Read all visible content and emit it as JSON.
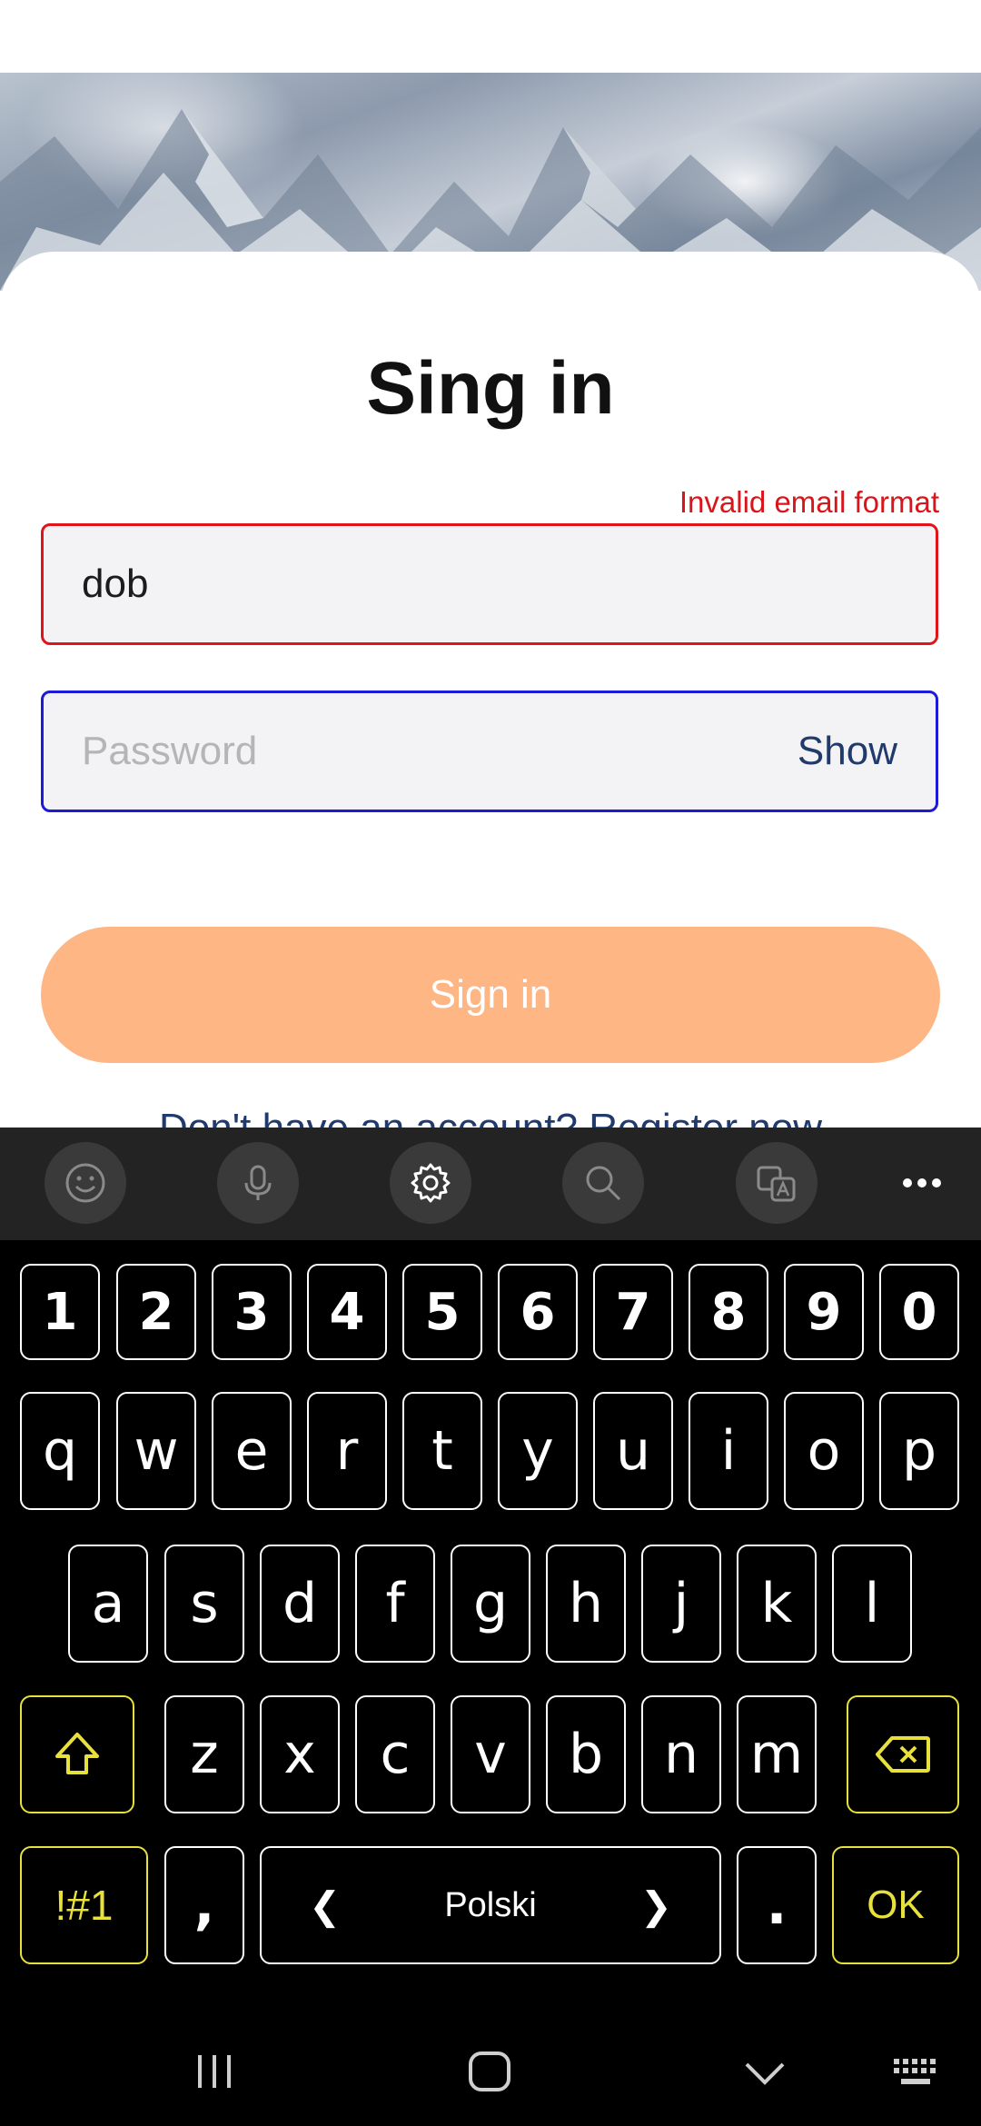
{
  "form": {
    "title": "Sing in",
    "email_error": "Invalid email format",
    "email_value": "dob",
    "password_placeholder": "Password",
    "show_label": "Show",
    "signin_label": "Sign in",
    "register_text": "Don't have an account? Register now"
  },
  "keyboard": {
    "toolbar_icons": [
      "emoji-icon",
      "microphone-icon",
      "settings-icon",
      "search-icon",
      "translate-icon",
      "more-icon"
    ],
    "row_numbers": [
      "1",
      "2",
      "3",
      "4",
      "5",
      "6",
      "7",
      "8",
      "9",
      "0"
    ],
    "row_top": [
      "q",
      "w",
      "e",
      "r",
      "t",
      "y",
      "u",
      "i",
      "o",
      "p"
    ],
    "row_mid": [
      "a",
      "s",
      "d",
      "f",
      "g",
      "h",
      "j",
      "k",
      "l"
    ],
    "row_bottom": [
      "z",
      "x",
      "c",
      "v",
      "b",
      "n",
      "m"
    ],
    "symbols_label": "!#1",
    "comma_label": ",",
    "space_label": "Polski",
    "period_label": ".",
    "ok_label": "OK",
    "accent_color": "#e8e03c"
  },
  "colors": {
    "error": "#d9151b",
    "focus_border": "#1d1ad8",
    "button": "#fdb684",
    "link": "#1f3a6b"
  }
}
